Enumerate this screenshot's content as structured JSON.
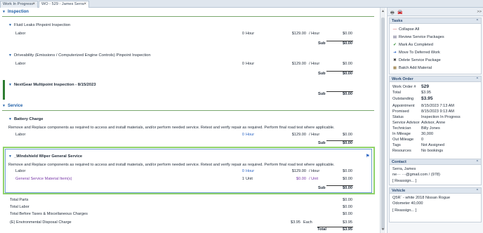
{
  "tabs": [
    {
      "label": "Work In Progress",
      "close": "×"
    },
    {
      "label": "WO - 529 - James Serra",
      "close": "×"
    }
  ],
  "scrollbar": {
    "up": "▲",
    "down": "▼"
  },
  "main": {
    "inspection": {
      "header": "Inspection",
      "op1": {
        "title": "Fluid Leaks Pinpoint Inspection",
        "labor": {
          "name": "Labor",
          "qty": "0",
          "unit": "Hour",
          "price": "$129.00",
          "per": "/ Hour",
          "total": "$0.00"
        },
        "sub_label": "Sub",
        "sub_total": "$0.00"
      },
      "op2": {
        "title": "Driveability (Emissions / Computerized Engine Controls) Pinpoint Inspection",
        "labor": {
          "name": "Labor",
          "qty": "0",
          "unit": "Hour",
          "price": "$129.00",
          "per": "/ Hour",
          "total": "$0.00"
        },
        "sub_label": "Sub",
        "sub_total": "$0.00"
      },
      "op3": {
        "title": "NextGear Multipoint Inspection - 8/15/2023",
        "sub_label": "Sub",
        "sub_total": "$0.00"
      }
    },
    "service": {
      "header": "Service",
      "battery": {
        "title": "Battery Charge",
        "desc": "Remove and Replace components as required to access and install materials, and/or perform needed service.  Retest and verify repair as required.  Perform final road test where applicable.",
        "labor": {
          "name": "Labor",
          "qty": "0",
          "unit": "Hour",
          "price": "$129.00",
          "per": "/ Hour",
          "total": "$0.00"
        },
        "sub_label": "Sub",
        "sub_total": "$0.00"
      },
      "wiper": {
        "title": "_Windshield Wiper General Service",
        "desc": "Remove and Replace components as required to access and install materials, and/or perform needed service.  Retest and verify repair as required.  Perform final road test where applicable.",
        "labor": {
          "name": "Labor",
          "qty": "0",
          "unit": "Hour",
          "price": "$129.00",
          "per": "/ Hour",
          "total": "$0.00"
        },
        "material": {
          "name": "General Service Material Item(s)",
          "qty": "1",
          "unit": "Unit",
          "price": "$0.00",
          "per": "/ Unit",
          "total": "$0.00"
        },
        "sub_label": "Sub",
        "sub_total": "$0.00"
      }
    },
    "totals": {
      "parts": {
        "label": "Total Parts",
        "value": "$0.00"
      },
      "labor": {
        "label": "Total Labor",
        "value": "$0.00"
      },
      "before_tax": {
        "label": "Total Before Taxes & Miscellaneous Charges",
        "value": "$0.00"
      },
      "env": {
        "label": "(E) Environmental Disposal Charge",
        "price": "$3.95",
        "each": "Each",
        "value": "$3.95"
      },
      "total": {
        "label": "Total",
        "value": "$3.95"
      }
    }
  },
  "sidebar": {
    "toolbar": {
      "expand": ">>"
    },
    "tasks": {
      "header": "Tasks",
      "chevron": "⌃",
      "items": [
        {
          "label": "Collapse All",
          "icon": "—"
        },
        {
          "label": "Review Service Packages",
          "icon": "▤"
        },
        {
          "label": "Mark As Completed",
          "icon": "✔"
        },
        {
          "label": "Move To Deferred Work",
          "icon": "➜"
        },
        {
          "label": "Delete Service Package",
          "icon": "✖"
        },
        {
          "label": "Batch Add Material",
          "icon": "▦"
        }
      ]
    },
    "work_order": {
      "header": "Work Order",
      "fields": [
        {
          "key": "Work Order #",
          "value": "529"
        },
        {
          "key": "Total",
          "value": "$3.95"
        },
        {
          "key": "Outstanding",
          "value": "$3.95"
        },
        {
          "key": "Appointment",
          "value": "8/15/2023 7:13 AM"
        },
        {
          "key": "Promised",
          "value": "8/15/2023 9:13 AM"
        },
        {
          "key": "Status",
          "value": "Inspection In Progress"
        },
        {
          "key": "Service Advisor",
          "value": "Advisor, Anne"
        },
        {
          "key": "Technician",
          "value": "Billy Jones"
        },
        {
          "key": "In Mileage",
          "value": "30,000"
        },
        {
          "key": "Out Mileage",
          "value": "0"
        },
        {
          "key": "Tags",
          "value": "Not Assigned"
        },
        {
          "key": "Resources",
          "value": "No bookings"
        }
      ]
    },
    "contact": {
      "header": "Contact",
      "name": "Serra, James",
      "email_phone": "ne···   ···@gmail.com / (978)",
      "reassign": "[ Reassign... ]"
    },
    "vehicle": {
      "header": "Vehicle",
      "line1": "Q5R`   - white 2018 Nissan Rogue",
      "line2": "Odometer 40,000",
      "reassign": "[ Reassign... ]"
    }
  }
}
